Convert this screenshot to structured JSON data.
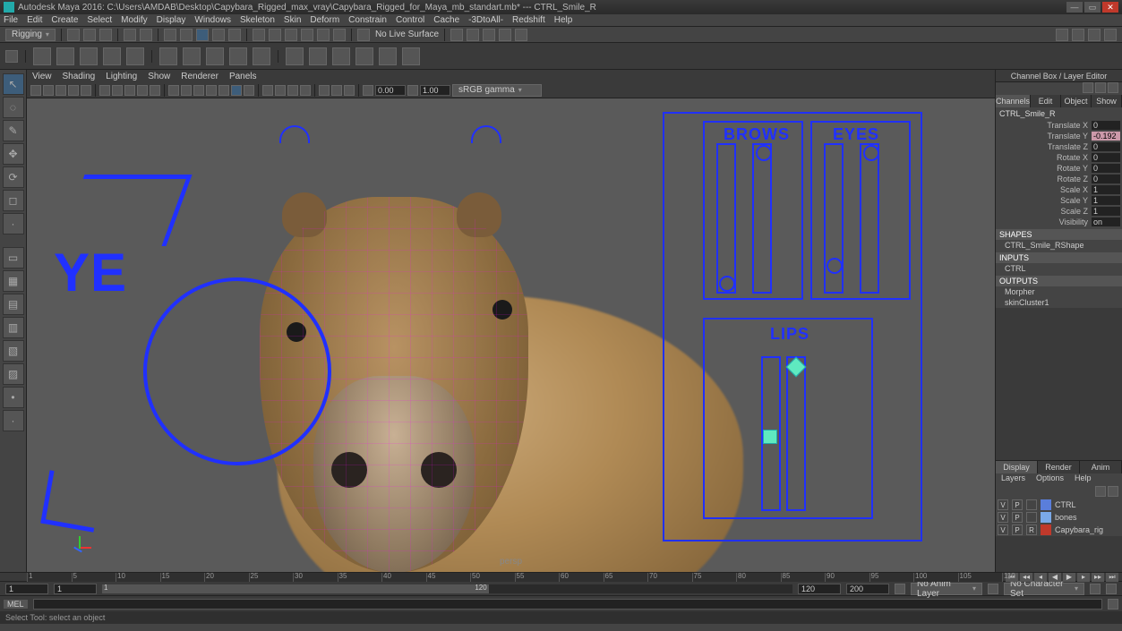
{
  "app": {
    "title": "Autodesk Maya 2016: C:\\Users\\AMDAB\\Desktop\\Capybara_Rigged_max_vray\\Capybara_Rigged_for_Maya_mb_standart.mb*  ---  CTRL_Smile_R"
  },
  "menu": [
    "File",
    "Edit",
    "Create",
    "Select",
    "Modify",
    "Display",
    "Windows",
    "Skeleton",
    "Skin",
    "Deform",
    "Constrain",
    "Control",
    "Cache",
    "-3DtoAll-",
    "Redshift",
    "Help"
  ],
  "moduleDropdown": "Rigging",
  "surfaceLabel": "No Live Surface",
  "panelMenus": [
    "View",
    "Shading",
    "Lighting",
    "Show",
    "Renderer",
    "Panels"
  ],
  "panelToolbar": {
    "field1": "0.00",
    "field2": "1.00",
    "colorSpace": "sRGB gamma"
  },
  "viewport": {
    "camera": "persp",
    "rigLabels": {
      "ye": "YE",
      "brows": "BROWS",
      "eyes": "EYES",
      "lips": "LIPS"
    }
  },
  "channelBox": {
    "title": "Channel Box / Layer Editor",
    "tabs": [
      "Channels",
      "Edit",
      "Object",
      "Show"
    ],
    "objectName": "CTRL_Smile_R",
    "attrs": [
      {
        "label": "Translate X",
        "value": "0",
        "hl": false
      },
      {
        "label": "Translate Y",
        "value": "-0.192",
        "hl": true
      },
      {
        "label": "Translate Z",
        "value": "0",
        "hl": false
      },
      {
        "label": "Rotate X",
        "value": "0",
        "hl": false
      },
      {
        "label": "Rotate Y",
        "value": "0",
        "hl": false
      },
      {
        "label": "Rotate Z",
        "value": "0",
        "hl": false
      },
      {
        "label": "Scale X",
        "value": "1",
        "hl": false
      },
      {
        "label": "Scale Y",
        "value": "1",
        "hl": false
      },
      {
        "label": "Scale Z",
        "value": "1",
        "hl": false
      },
      {
        "label": "Visibility",
        "value": "on",
        "hl": false
      }
    ],
    "sections": {
      "shapes": "SHAPES",
      "shapesItem": "CTRL_Smile_RShape",
      "inputs": "INPUTS",
      "inputsItem": "CTRL",
      "outputs": "OUTPUTS",
      "outputsItem1": "Morpher",
      "outputsItem2": "skinCluster1"
    }
  },
  "layerEditor": {
    "tabs": [
      "Display",
      "Render",
      "Anim"
    ],
    "activeTab": "Display",
    "menus": [
      "Layers",
      "Options",
      "Help"
    ],
    "layers": [
      {
        "v": "V",
        "p": "P",
        "r": "",
        "color": "#5a7edb",
        "name": "CTRL"
      },
      {
        "v": "V",
        "p": "P",
        "r": "",
        "color": "#7aa9e8",
        "name": "bones"
      },
      {
        "v": "V",
        "p": "P",
        "r": "R",
        "color": "#c0392b",
        "name": "Capybara_rig"
      }
    ]
  },
  "timeline": {
    "ticks": [
      1,
      5,
      10,
      15,
      20,
      25,
      30,
      35,
      40,
      45,
      50,
      55,
      60,
      65,
      70,
      75,
      80,
      85,
      90,
      95,
      100,
      105,
      110
    ],
    "current": 1
  },
  "range": {
    "startOuter": "1",
    "startInner": "1",
    "currentField": "1",
    "sliderLabel": "120",
    "endInner": "120",
    "endOuter": "200",
    "animLayer": "No Anim Layer",
    "characterSet": "No Character Set"
  },
  "cmd": {
    "lang": "MEL"
  },
  "help": "Select Tool: select an object"
}
